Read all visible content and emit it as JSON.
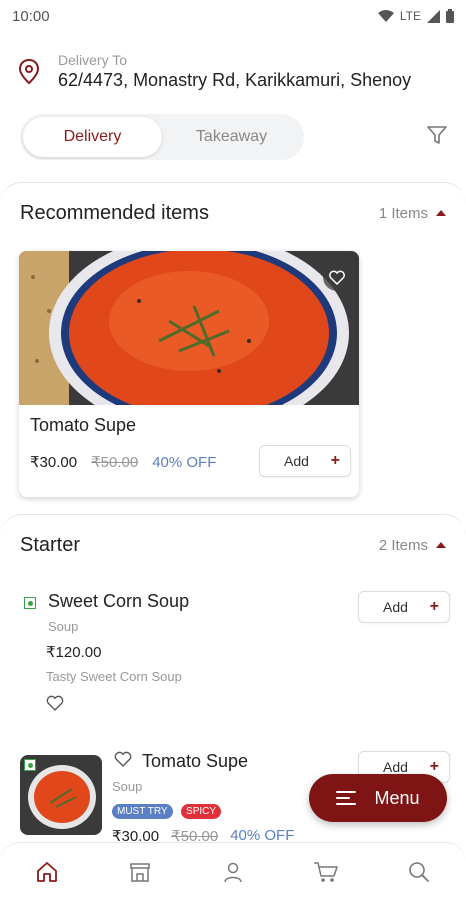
{
  "status_bar": {
    "time": "10:00",
    "network": "LTE"
  },
  "delivery": {
    "label": "Delivery To",
    "address": "62/4473, Monastry Rd, Karikkamuri, Shenoy"
  },
  "mode_toggle": {
    "delivery": "Delivery",
    "takeaway": "Takeaway",
    "selected": "Delivery"
  },
  "recommended": {
    "title": "Recommended items",
    "count": "1 Items",
    "items": [
      {
        "name": "Tomato Supe",
        "price": "₹30.00",
        "old_price": "₹50.00",
        "discount": "40% OFF",
        "add_label": "Add"
      }
    ]
  },
  "starter": {
    "title": "Starter",
    "count": "2 Items",
    "items": [
      {
        "name": "Sweet Corn Soup",
        "category": "Soup",
        "price": "₹120.00",
        "description": "Tasty Sweet Corn Soup",
        "add_label": "Add"
      },
      {
        "name": "Tomato Supe",
        "category": "Soup",
        "tags": [
          "MUST TRY",
          "SPICY"
        ],
        "price": "₹30.00",
        "old_price": "₹50.00",
        "discount": "40% OFF",
        "add_label": "Add"
      }
    ]
  },
  "menu_button": {
    "label": "Menu"
  },
  "bottom_nav": [
    "home-icon",
    "store-icon",
    "profile-icon",
    "cart-icon",
    "search-icon"
  ],
  "colors": {
    "brand": "#7e1414",
    "accent_text": "#8b1a1a",
    "discount": "#5a7fc4",
    "veg": "#3aa34a",
    "tag_must_try": "#5a7fc4",
    "tag_spicy": "#e0303a"
  }
}
